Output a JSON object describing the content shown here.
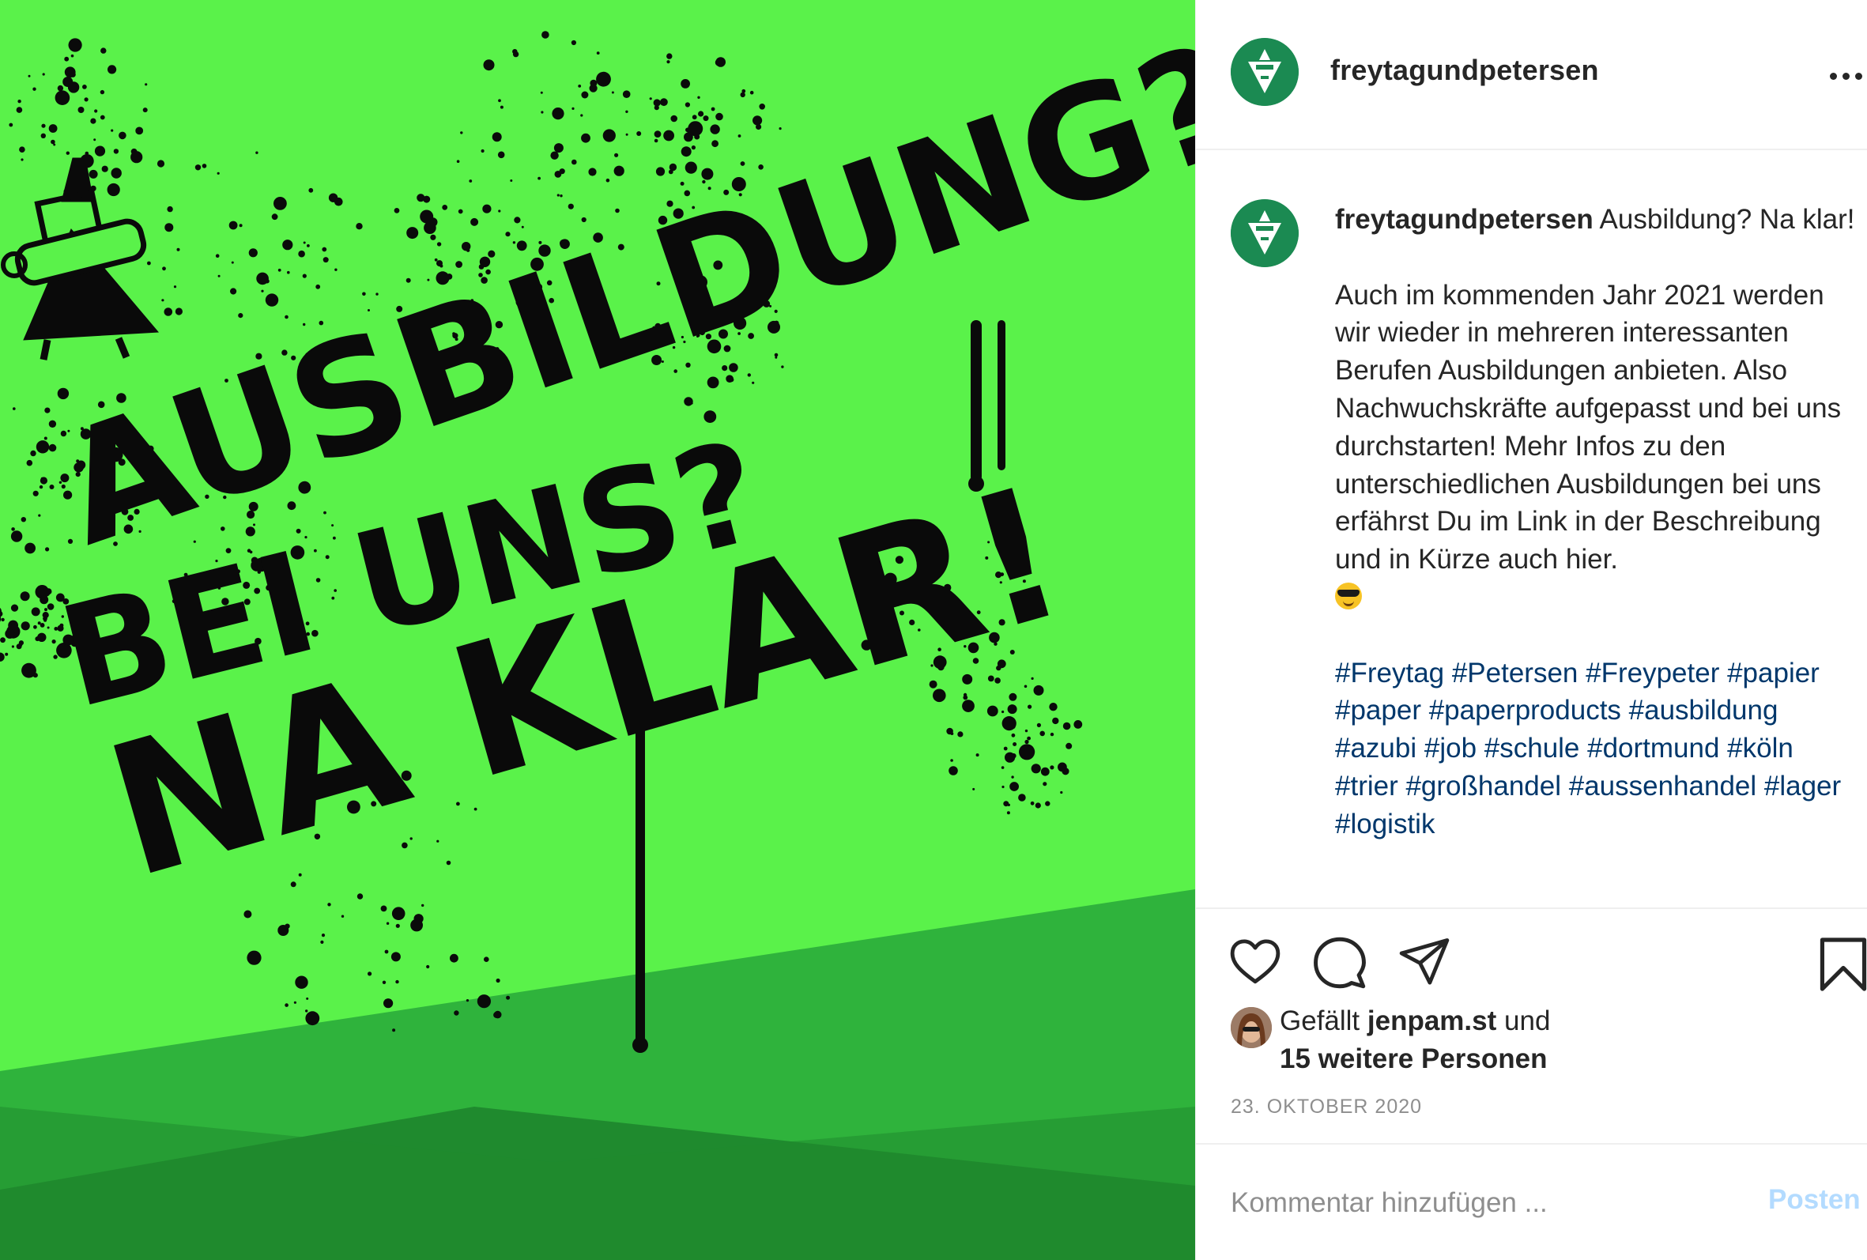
{
  "image": {
    "headline_lines": [
      "AUSBILDUNG?",
      "BEI UNS?",
      "NA KLAR!"
    ],
    "colors": {
      "bright_green": "#5af24a",
      "mid_green": "#2fb33c",
      "dark_green": "#1f8a2e",
      "ink": "#0a0a0a"
    }
  },
  "header": {
    "username": "freytagundpetersen",
    "more_icon": "more-horizontal-icon"
  },
  "caption": {
    "username": "freytagundpetersen",
    "title": "Ausbildung? Na klar!",
    "paragraph": "Auch im kommenden Jahr 2021 werden wir wieder in mehreren interessanten Berufen Ausbildungen anbieten. Also Nachwuchskräfte aufgepasst und bei uns durchstarten! Mehr Infos zu den unterschiedlichen Ausbildungen bei uns erfährst Du im Link in der Beschreibung und in Kürze auch hier.",
    "emoji": "smiling-face-with-sunglasses",
    "hashtags": "#Freytag #Petersen #Freypeter #papier #paper #paperproducts #ausbildung #azubi #job #schule #dortmund #köln #trier #großhandel #aussenhandel #lager #logistik"
  },
  "actions": {
    "like_icon": "heart-icon",
    "comment_icon": "comment-icon",
    "share_icon": "paper-plane-icon",
    "save_icon": "bookmark-icon"
  },
  "likes": {
    "prefix": "Gefällt",
    "liker": "jenpam.st",
    "connector": "und",
    "others": "15 weitere Personen"
  },
  "date": "23. OKTOBER 2020",
  "comment": {
    "placeholder": "Kommentar hinzufügen ...",
    "post_label": "Posten",
    "post_color": "#b3dbff"
  },
  "accent": {
    "link": "#00376b",
    "brand_green": "#1b8a52"
  }
}
